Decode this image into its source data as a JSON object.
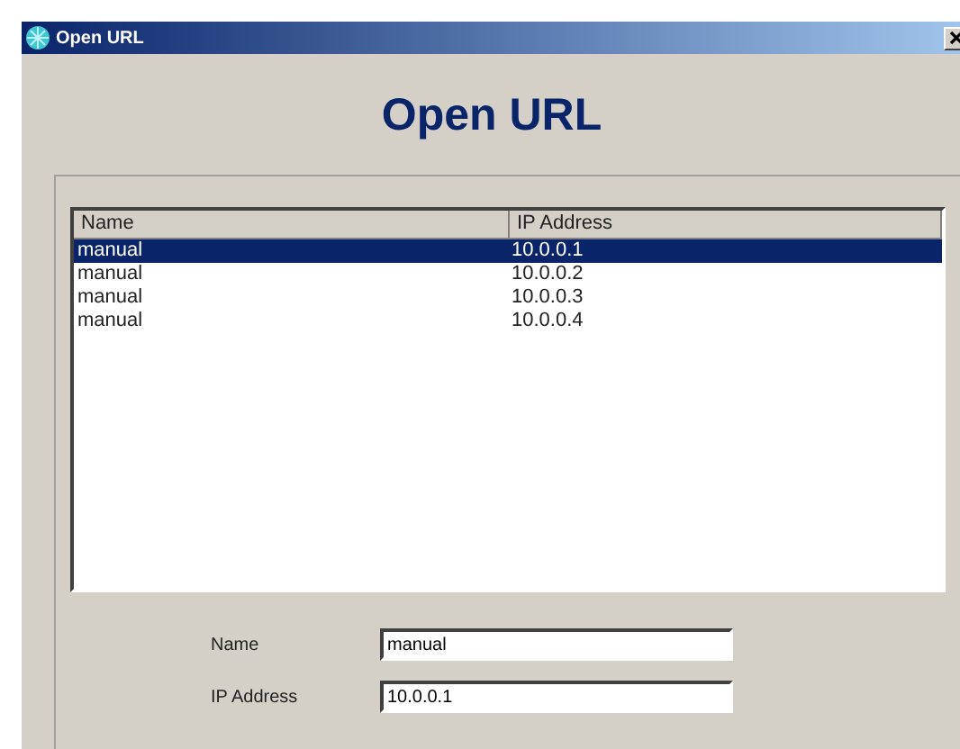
{
  "window": {
    "title": "Open URL"
  },
  "heading": "Open URL",
  "table": {
    "columns": [
      "Name",
      "IP Address"
    ],
    "rows": [
      {
        "cells": [
          "manual",
          "10.0.0.1"
        ],
        "selected": true
      },
      {
        "cells": [
          "manual",
          "10.0.0.2"
        ],
        "selected": false
      },
      {
        "cells": [
          "manual",
          "10.0.0.3"
        ],
        "selected": false
      },
      {
        "cells": [
          "manual",
          "10.0.0.4"
        ],
        "selected": false
      }
    ]
  },
  "form": [
    {
      "label": "Name",
      "value": "manual"
    },
    {
      "label": "IP Address",
      "value": "10.0.0.1"
    }
  ]
}
